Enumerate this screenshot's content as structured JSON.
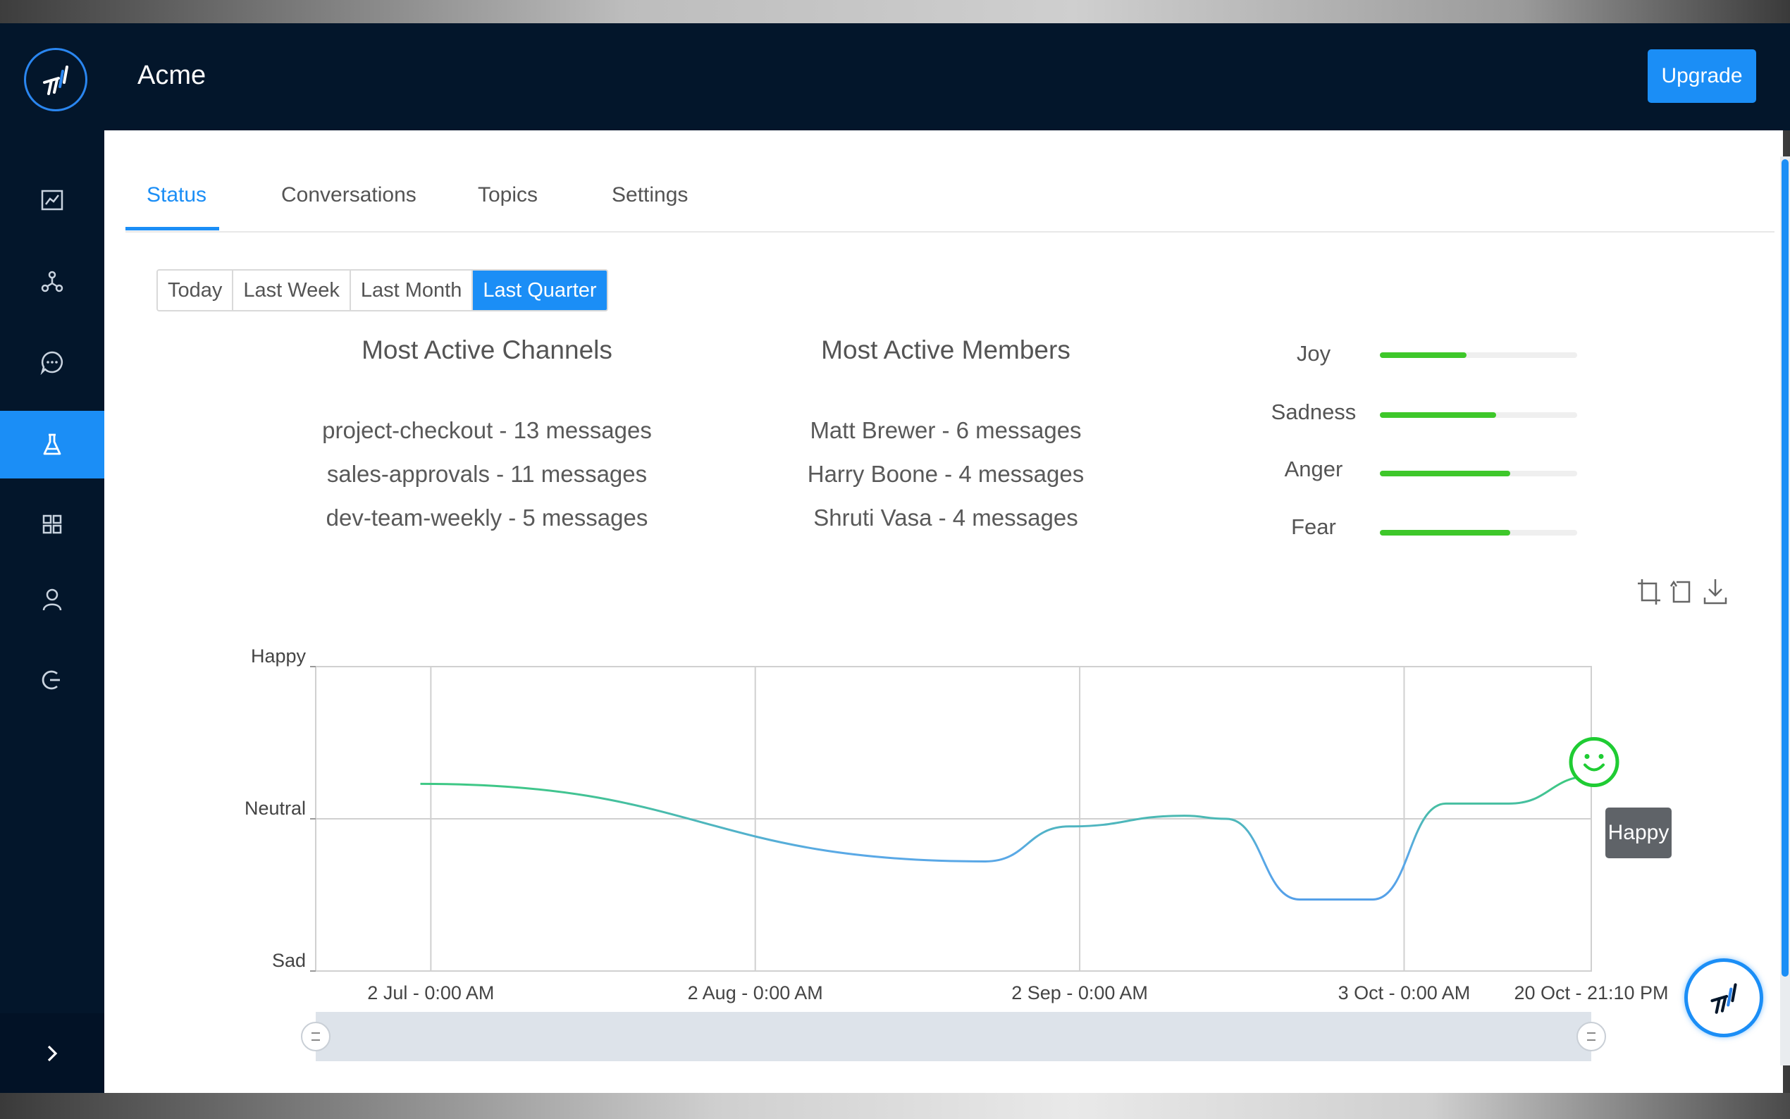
{
  "header": {
    "title": "Acme",
    "upgrade_label": "Upgrade"
  },
  "sidebar": {
    "items": [
      {
        "icon": "line-chart-icon",
        "active": false
      },
      {
        "icon": "network-icon",
        "active": false
      },
      {
        "icon": "chat-bubble-icon",
        "active": false
      },
      {
        "icon": "flask-icon",
        "active": true
      },
      {
        "icon": "grid-icon",
        "active": false
      },
      {
        "icon": "user-icon",
        "active": false
      },
      {
        "icon": "logout-icon",
        "active": false
      }
    ],
    "expand_icon": "chevron-right-icon"
  },
  "tabs": [
    {
      "label": "Status",
      "active": true
    },
    {
      "label": "Conversations",
      "active": false
    },
    {
      "label": "Topics",
      "active": false
    },
    {
      "label": "Settings",
      "active": false
    }
  ],
  "ranges": [
    {
      "label": "Today",
      "active": false
    },
    {
      "label": "Last Week",
      "active": false
    },
    {
      "label": "Last Month",
      "active": false
    },
    {
      "label": "Last Quarter",
      "active": true
    }
  ],
  "channels": {
    "title": "Most Active Channels",
    "items": [
      "project-checkout - 13 messages",
      "sales-approvals - 11 messages",
      "dev-team-weekly - 5 messages"
    ]
  },
  "members": {
    "title": "Most Active Members",
    "items": [
      "Matt Brewer - 6 messages",
      "Harry Boone - 4 messages",
      "Shruti Vasa - 4 messages"
    ]
  },
  "emotions": [
    {
      "label": "Joy",
      "level": 0.44
    },
    {
      "label": "Sadness",
      "level": 0.59
    },
    {
      "label": "Anger",
      "level": 0.66
    },
    {
      "label": "Fear",
      "level": 0.66
    }
  ],
  "colors": {
    "accent": "#1b8ef6",
    "dark": "#03162b",
    "positive": "#3ec72a"
  },
  "chart_toolbar": [
    "crop-icon",
    "reset-crop-icon",
    "download-icon"
  ],
  "chart_data": {
    "type": "line",
    "y_categories": [
      "Sad",
      "Neutral",
      "Happy"
    ],
    "x_tick_labels": [
      "2 Jul - 0:00 AM",
      "2 Aug - 0:00 AM",
      "2 Sep - 0:00 AM",
      "3 Oct - 0:00 AM",
      "20 Oct - 21:10 PM"
    ],
    "x_ticks": [
      "2024-07-02T00:00",
      "2024-08-02T00:00",
      "2024-09-02T00:00",
      "2024-10-03T00:00",
      "2024-10-20T21:10"
    ],
    "x_range": [
      "2024-06-21T00:00",
      "2024-10-20T21:10"
    ],
    "ylim": [
      -1,
      1
    ],
    "grid": true,
    "points": [
      {
        "x": "2024-07-01T00:00",
        "y": 0.23
      },
      {
        "x": "2024-08-24T00:00",
        "y": -0.28
      },
      {
        "x": "2024-09-01T00:00",
        "y": -0.05
      },
      {
        "x": "2024-09-12T00:00",
        "y": 0.02
      },
      {
        "x": "2024-09-16T00:00",
        "y": 0.0
      },
      {
        "x": "2024-09-23T00:00",
        "y": -0.53
      },
      {
        "x": "2024-09-30T00:00",
        "y": -0.53
      },
      {
        "x": "2024-10-07T00:00",
        "y": 0.1
      },
      {
        "x": "2024-10-13T00:00",
        "y": 0.1
      },
      {
        "x": "2024-10-20T21:10",
        "y": 0.28
      }
    ],
    "current_label": "Happy"
  }
}
